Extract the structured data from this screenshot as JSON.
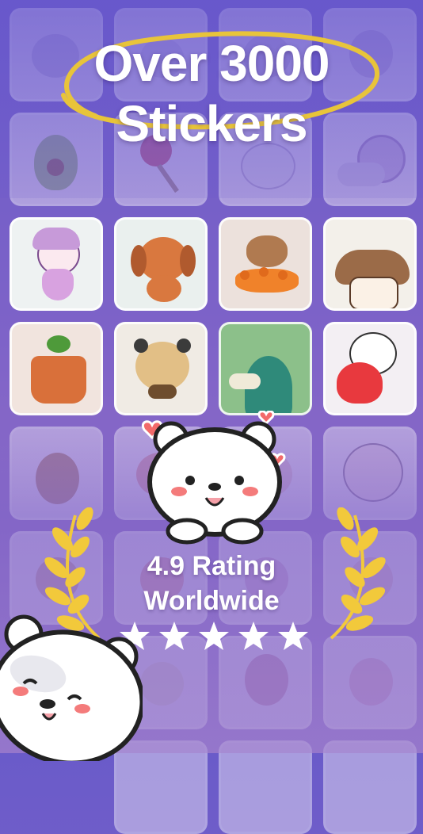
{
  "headline": {
    "line1": "Over 3000",
    "line2": "Stickers"
  },
  "rating": {
    "line1": "4.9 Rating",
    "line2": "Worldwide",
    "stars": 5
  },
  "colors": {
    "background_top": "#6a5bc9",
    "background_bottom": "#a080cf",
    "accent_circle": "#e8c43a",
    "laurel": "#f2c93b",
    "heart": "#f26a6a"
  },
  "tiles": [
    {
      "name": "sticker-tile",
      "icon": "cat-sticker-icon"
    },
    {
      "name": "sticker-tile",
      "icon": "avocado-sticker-icon"
    },
    {
      "name": "sticker-tile",
      "icon": "lollipop-sticker-icon"
    },
    {
      "name": "sticker-tile",
      "icon": "snail-sticker-icon"
    },
    {
      "name": "sticker-tile",
      "icon": "unicorn-mermaid-sticker-icon"
    },
    {
      "name": "sticker-tile",
      "icon": "puppy-sticker-icon"
    },
    {
      "name": "sticker-tile",
      "icon": "capybara-oranges-sticker-icon"
    },
    {
      "name": "sticker-tile",
      "icon": "mushroom-sticker-icon"
    },
    {
      "name": "sticker-tile",
      "icon": "plant-pot-sticker-icon"
    },
    {
      "name": "sticker-tile",
      "icon": "panda-hamster-sticker-icon"
    },
    {
      "name": "sticker-tile",
      "icon": "duck-sticker-icon"
    },
    {
      "name": "sticker-tile",
      "icon": "bear-heart-sticker-icon"
    }
  ]
}
